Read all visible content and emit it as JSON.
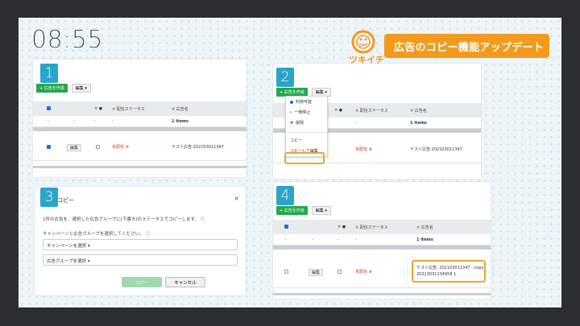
{
  "clock": "08:55",
  "banner": "広告のコピー機能アップデート",
  "logo": {
    "text": "ツキイチ",
    "color": "#f39a1c"
  },
  "badges": [
    "1",
    "2",
    "3",
    "4"
  ],
  "toolbar": {
    "create_label": "+ 広告を作成",
    "edit_label": "編集 ▾"
  },
  "table": {
    "headers": {
      "sort": "≑ ●",
      "status": "≑ 配信ステータス",
      "name": "≑ 広告名"
    },
    "summary": {
      "dash": "-",
      "count": "1 items"
    },
    "row": {
      "edit": "編集",
      "status": "未配信 ⊗",
      "name_before": "テスト広告:202103011347",
      "name_after_1": "テスト広告: 202103011347 - copy",
      "name_after_2": "20213031134958 1"
    }
  },
  "menu": [
    "利用可能",
    "一時停止",
    "削除",
    "コピー",
    "コピーして編集"
  ],
  "modal": {
    "title": "コピー",
    "close": "×",
    "line1": "1件の広告を、選択した広告グループに[下書き]のステータスでコピーします。 ⓘ",
    "line2": "キャンペーンと広告グループを選択してください。 ⓘ",
    "campaign_placeholder": "キャンペーンを選択 ▾",
    "adgroup_placeholder": "広告グループを選択 ▾",
    "copy_btn": "コピー",
    "cancel_btn": "キャンセル"
  },
  "colors": {
    "accent": "#f39a1c",
    "badge": "#2aa5c9",
    "green": "#22a94b",
    "highlight": "#f2a132"
  }
}
